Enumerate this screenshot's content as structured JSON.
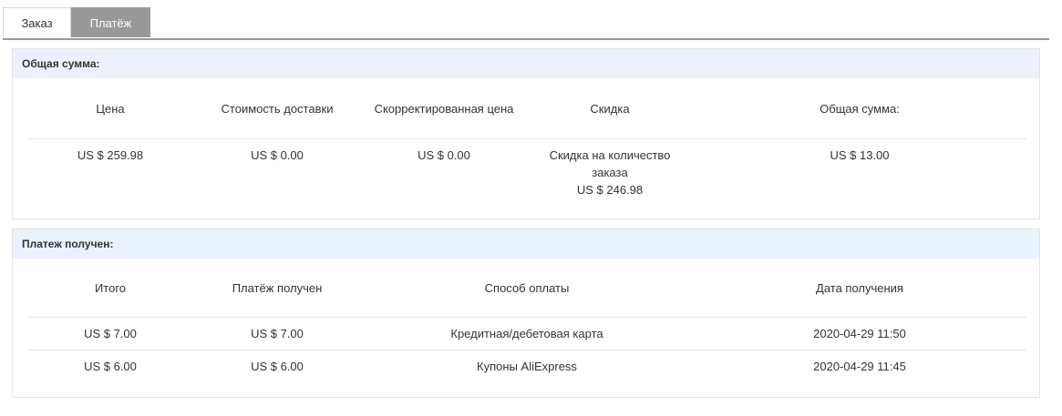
{
  "tabs": [
    {
      "label": "Заказ",
      "active": false
    },
    {
      "label": "Платёж",
      "active": true
    }
  ],
  "totals": {
    "header": "Общая сумма:",
    "columns": [
      "Цена",
      "Стоимость доставки",
      "Скорректированная цена",
      "Скидка",
      "Общая сумма:"
    ],
    "row": {
      "price": "US $ 259.98",
      "shipping": "US $ 0.00",
      "adjusted": "US $ 0.00",
      "discount_label_1": "Скидка на количество",
      "discount_label_2": "заказа",
      "discount_value": "US $ 246.98",
      "total": "US $ 13.00"
    }
  },
  "payments": {
    "header": "Платеж получен:",
    "columns": [
      "Итого",
      "Платёж получен",
      "Способ оплаты",
      "Дата получения"
    ],
    "rows": [
      {
        "total": "US $ 7.00",
        "received": "US $ 7.00",
        "method": "Кредитная/дебетовая карта",
        "date": "2020-04-29 11:50"
      },
      {
        "total": "US $ 6.00",
        "received": "US $ 6.00",
        "method": "Купоны AliExpress",
        "date": "2020-04-29 11:45"
      }
    ]
  },
  "colors": {
    "tab_active_bg": "#999999",
    "panel_header_bg": "#eaf2fd",
    "border": "#e3e3e3"
  }
}
